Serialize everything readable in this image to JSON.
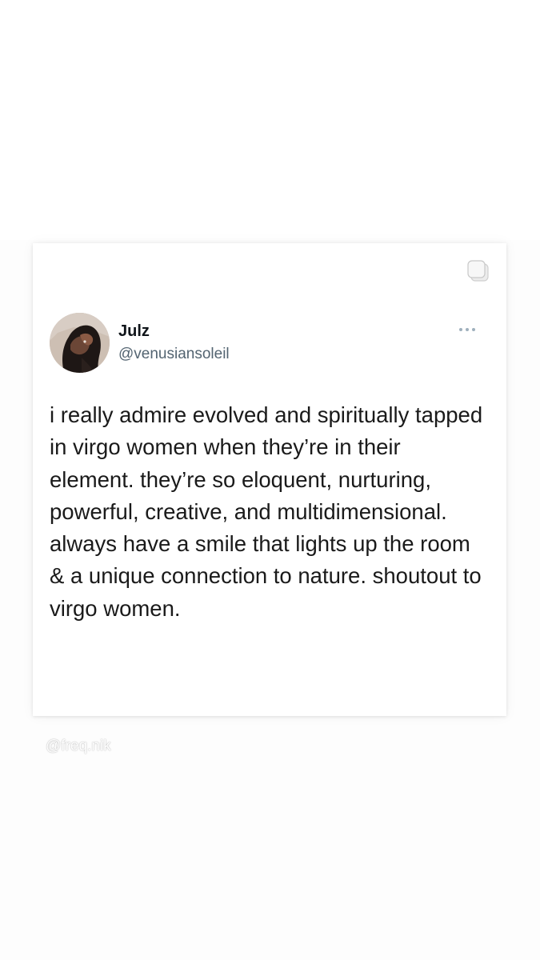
{
  "tweet": {
    "author_name": "Julz",
    "author_handle": "@venusiansoleil",
    "text": "i really admire evolved and spiritually tapped in virgo women when they’re in their element. they’re so eloquent, nurturing, powerful, creative, and multidimensional. always have a smile that lights up the room & a unique connection to nature. shoutout to virgo women."
  },
  "icons": {
    "copy": "copy-icon",
    "more": "more-options-icon",
    "avatar": "avatar"
  },
  "watermark": "@freq.nik",
  "colors": {
    "name": "#0f1419",
    "handle": "#536471",
    "text": "#1a1a1a",
    "card_background": "#ffffff"
  }
}
